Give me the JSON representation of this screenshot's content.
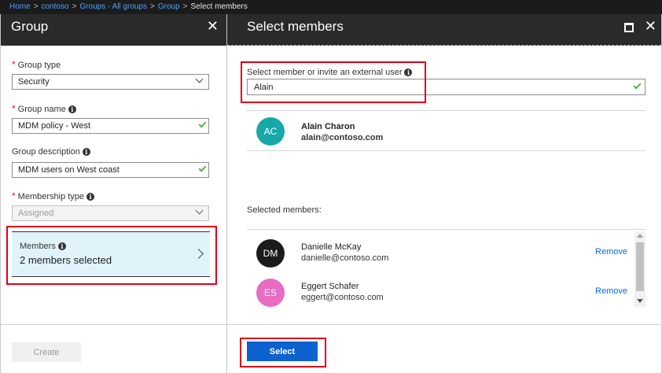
{
  "breadcrumb": {
    "items": [
      "Home",
      "contoso",
      "Groups - All groups",
      "Group"
    ],
    "current": "Select members",
    "separator": ">"
  },
  "left_blade": {
    "title": "Group",
    "close_glyph": "✕",
    "group_type": {
      "label": "Group type",
      "value": "Security"
    },
    "group_name": {
      "label": "Group name",
      "value": "MDM policy - West"
    },
    "group_description": {
      "label": "Group description",
      "value": "MDM users on West coast"
    },
    "membership_type": {
      "label": "Membership type",
      "value": "Assigned"
    },
    "members": {
      "label": "Members",
      "value": "2 members selected"
    },
    "create_label": "Create"
  },
  "right_blade": {
    "title": "Select members",
    "close_glyph": "✕",
    "search": {
      "label": "Select member or invite an external user",
      "value": "Alain"
    },
    "result": {
      "initials": "AC",
      "name": "Alain Charon",
      "email": "alain@contoso.com"
    },
    "selected_label": "Selected members:",
    "selected": [
      {
        "initials": "DM",
        "name": "Danielle McKay",
        "email": "danielle@contoso.com",
        "remove_label": "Remove"
      },
      {
        "initials": "ES",
        "name": "Eggert Schafer",
        "email": "eggert@contoso.com",
        "remove_label": "Remove"
      }
    ],
    "select_label": "Select"
  },
  "info_glyph": "i",
  "colors": {
    "accent": "#0e62cf",
    "highlight": "#e0001a",
    "avatar_ac": "#17a8a8",
    "avatar_dm": "#1b1b1b",
    "avatar_es": "#e86cc4",
    "members_bg": "#e0f3fb"
  }
}
